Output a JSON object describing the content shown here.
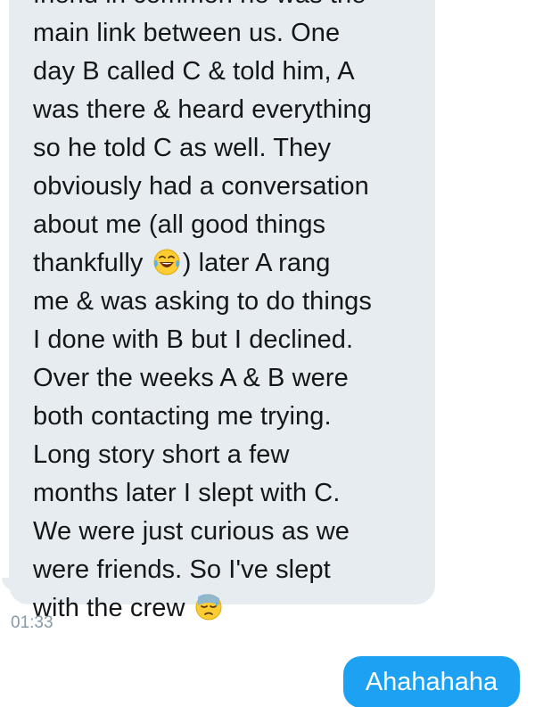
{
  "conversation": {
    "incoming": {
      "lines": [
        "friend in common he was the",
        "main link between us. One",
        "day B called C & told him, A",
        "was there & heard everything",
        "so he told C as well. They",
        "obviously had a conversation",
        "about me (all good things",
        "thankfully",
        ") later A rang",
        "me & was asking to do things",
        "I done with B but I declined.",
        "Over the weeks A & B were",
        "both contacting me trying.",
        "Long story short a few",
        "months later I slept with C.",
        "We were just curious as we",
        "were friends. So I've slept",
        "with the crew"
      ],
      "emoji_1": "face-with-tears-of-joy-icon",
      "emoji_2": "downcast-face-with-sweat-icon",
      "timestamp": "01:33"
    },
    "outgoing": {
      "text": "Ahahahaha"
    }
  },
  "colors": {
    "incoming_bubble": "#e6ecf0",
    "outgoing_bubble": "#1da1f2",
    "text": "#14171a",
    "timestamp": "#8899a6"
  }
}
